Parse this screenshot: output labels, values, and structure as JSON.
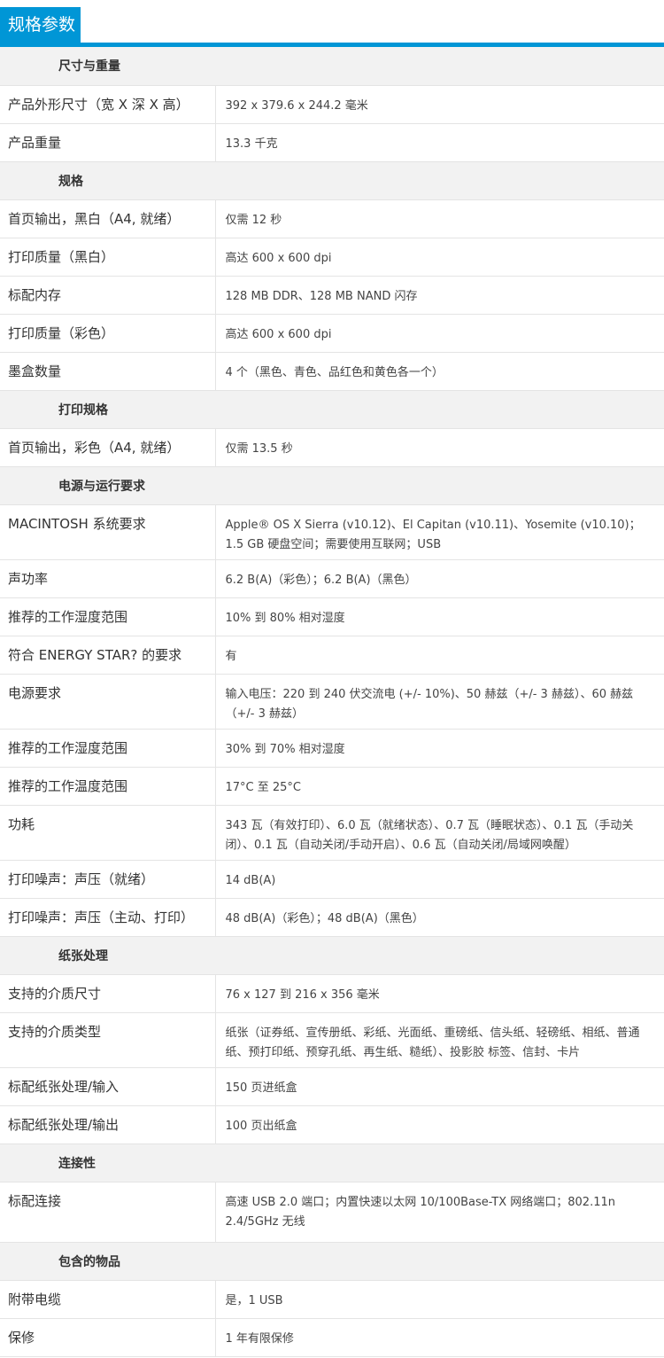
{
  "header": {
    "title": "规格参数"
  },
  "colors": {
    "accent": "#0096d6",
    "section_bg": "#f2f2f2",
    "border": "#e4e4e4"
  },
  "sections": [
    {
      "title": "尺寸与重量",
      "rows": [
        {
          "label": "产品外形尺寸（宽 X 深 X 高）",
          "value": "392 x 379.6 x 244.2 毫米"
        },
        {
          "label": "产品重量",
          "value": "13.3 千克"
        }
      ]
    },
    {
      "title": "规格",
      "rows": [
        {
          "label": "首页输出，黑白（A4, 就绪）",
          "value": "仅需 12 秒"
        },
        {
          "label": "打印质量（黑白）",
          "value": "高达 600 x 600 dpi"
        },
        {
          "label": "标配内存",
          "value": "128 MB DDR、128 MB NAND 闪存"
        },
        {
          "label": "打印质量（彩色）",
          "value": "高达 600 x 600 dpi"
        },
        {
          "label": "墨盒数量",
          "value": "4 个（黑色、青色、品红色和黄色各一个）"
        }
      ]
    },
    {
      "title": "打印规格",
      "rows": [
        {
          "label": "首页输出，彩色（A4, 就绪）",
          "value": "仅需 13.5 秒"
        }
      ]
    },
    {
      "title": "电源与运行要求",
      "rows": [
        {
          "label": "MACINTOSH 系统要求",
          "value": "Apple® OS X Sierra (v10.12)、El Capitan (v10.11)、Yosemite (v10.10)；1.5 GB 硬盘空间；需要使用互联网；USB"
        },
        {
          "label": "声功率",
          "value": "6.2 B(A)（彩色）；6.2 B(A)（黑色）"
        },
        {
          "label": "推荐的工作湿度范围",
          "value": "10% 到 80% 相对湿度"
        },
        {
          "label": "符合 ENERGY STAR? 的要求",
          "value": "有"
        },
        {
          "label": "电源要求",
          "value": "输入电压：220 到 240 伏交流电 (+/- 10%)、50 赫兹（+/- 3 赫兹）、60 赫兹（+/- 3 赫兹）"
        },
        {
          "label": "推荐的工作湿度范围",
          "value": "30% 到 70% 相对湿度"
        },
        {
          "label": "推荐的工作温度范围",
          "value": "17°C 至 25°C"
        },
        {
          "label": "功耗",
          "value": "343 瓦（有效打印）、6.0 瓦（就绪状态）、0.7 瓦（睡眠状态）、0.1 瓦（手动关闭）、0.1 瓦（自动关闭/手动开启）、0.6 瓦（自动关闭/局域网唤醒）"
        },
        {
          "label": "打印噪声：声压（就绪）",
          "value": "14 dB(A)"
        },
        {
          "label": "打印噪声：声压（主动、打印）",
          "value": "48 dB(A)（彩色）；48 dB(A)（黑色）"
        }
      ]
    },
    {
      "title": "纸张处理",
      "rows": [
        {
          "label": "支持的介质尺寸",
          "value": "76 x 127 到 216 x 356 毫米"
        },
        {
          "label": "支持的介质类型",
          "value": "纸张（证券纸、宣传册纸、彩纸、光面纸、重磅纸、信头纸、轻磅纸、相纸、普通纸、预打印纸、预穿孔纸、再生纸、糙纸）、投影胶 标签、信封、卡片"
        },
        {
          "label": "标配纸张处理/输入",
          "value": "150 页进纸盒"
        },
        {
          "label": "标配纸张处理/输出",
          "value": "100 页出纸盒"
        }
      ]
    },
    {
      "title": "连接性",
      "rows": [
        {
          "label": "标配连接",
          "value": "高速 USB 2.0 端口；内置快速以太网 10/100Base-TX 网络端口；802.11n 2.4/5GHz 无线"
        }
      ]
    },
    {
      "title": "包含的物品",
      "rows": [
        {
          "label": "附带电缆",
          "value": "是，1 USB"
        },
        {
          "label": "保修",
          "value": "1 年有限保修"
        }
      ]
    }
  ]
}
